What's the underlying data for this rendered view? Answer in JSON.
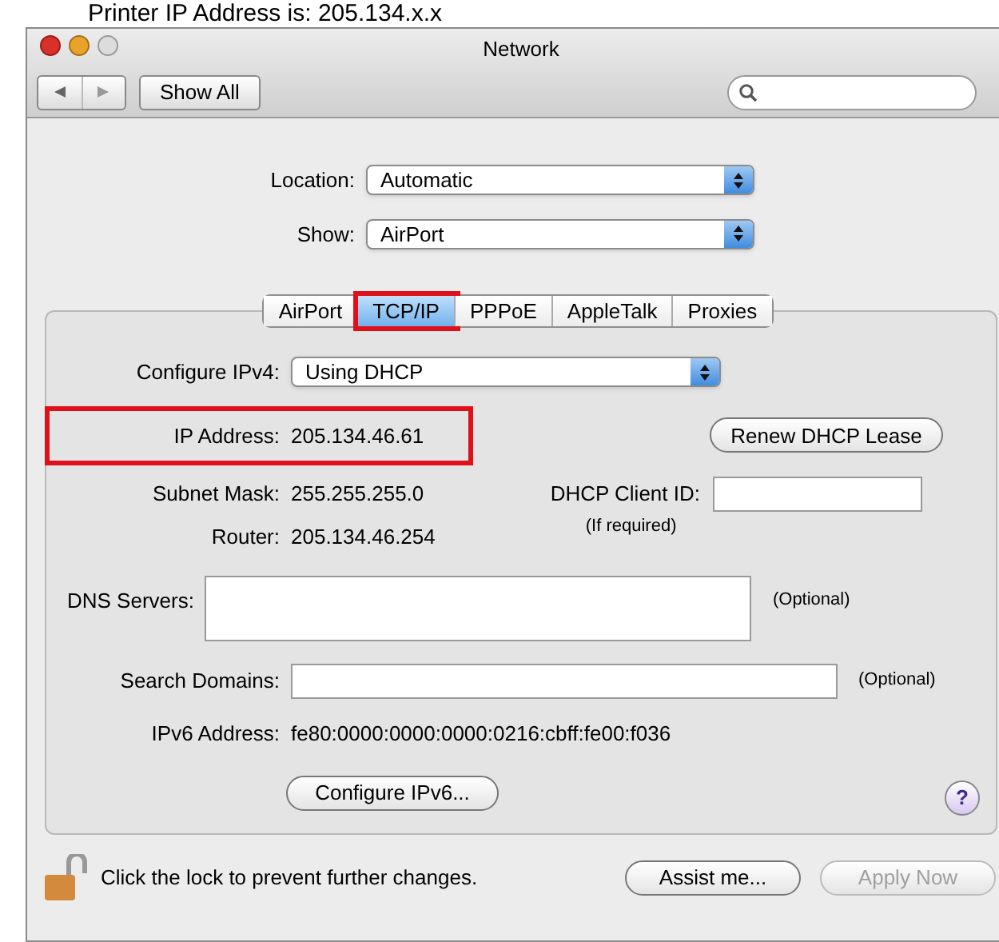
{
  "caption": "Printer IP  Address is: 205.134.x.x",
  "window": {
    "title": "Network"
  },
  "toolbar": {
    "show_all": "Show All"
  },
  "location": {
    "label": "Location:",
    "value": "Automatic"
  },
  "show": {
    "label": "Show:",
    "value": "AirPort"
  },
  "tabs": [
    {
      "label": "AirPort",
      "selected": false,
      "annotated": false
    },
    {
      "label": "TCP/IP",
      "selected": true,
      "annotated": true
    },
    {
      "label": "PPPoE",
      "selected": false,
      "annotated": false
    },
    {
      "label": "AppleTalk",
      "selected": false,
      "annotated": false
    },
    {
      "label": "Proxies",
      "selected": false,
      "annotated": false
    }
  ],
  "configure_ipv4": {
    "label": "Configure IPv4:",
    "value": "Using DHCP"
  },
  "ip_address": {
    "label": "IP Address:",
    "value": "205.134.46.61",
    "annotated": true
  },
  "renew_button": "Renew DHCP Lease",
  "subnet_mask": {
    "label": "Subnet Mask:",
    "value": "255.255.255.0"
  },
  "dhcp_client_id": {
    "label": "DHCP Client ID:",
    "hint": "(If required)"
  },
  "router": {
    "label": "Router:",
    "value": "205.134.46.254"
  },
  "dns_servers": {
    "label": "DNS Servers:",
    "note": "(Optional)"
  },
  "search_domains": {
    "label": "Search Domains:",
    "note": "(Optional)"
  },
  "ipv6_address": {
    "label": "IPv6 Address:",
    "value": "fe80:0000:0000:0000:0216:cbff:fe00:f036"
  },
  "configure_ipv6_button": "Configure IPv6...",
  "help": "?",
  "footer": {
    "lock_text": "Click the lock to prevent further changes.",
    "buttons": [
      {
        "label": "Assist me...",
        "disabled": false
      },
      {
        "label": "Apply Now",
        "disabled": true
      }
    ]
  }
}
